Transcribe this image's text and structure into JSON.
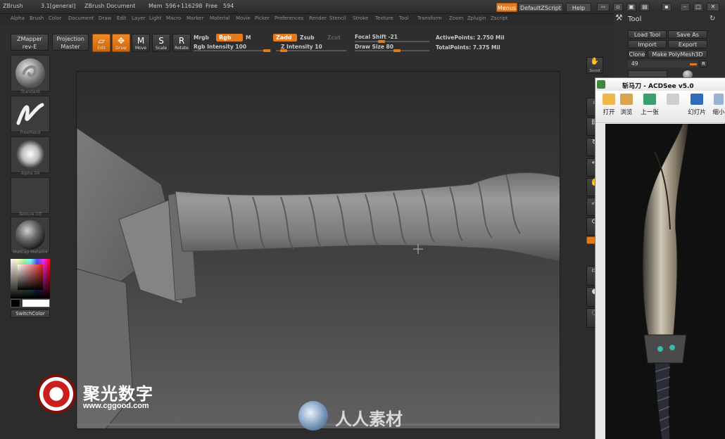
{
  "titlebar": {
    "app": "ZBrush",
    "version": "3.1[general]",
    "document": "ZBrush Document",
    "mem": "Mem",
    "mem_value": "596+116298",
    "free": "Free",
    "free_value": "594",
    "menus_btn": "Menus",
    "script_btn": "DefaultZScript",
    "help_btn": "Help"
  },
  "menubar": [
    "Alpha",
    "Brush",
    "Color",
    "Document",
    "Draw",
    "Edit",
    "Layer",
    "Light",
    "Macro",
    "Marker",
    "Material",
    "Movie",
    "Picker",
    "Preferences",
    "Render",
    "Stencil",
    "Stroke",
    "Texture",
    "Tool",
    "Transform",
    "Zoom",
    "Zplugin",
    "Zscript"
  ],
  "toolbar": {
    "zmapper": "ZMapper",
    "zmapper_sub": "rev-E",
    "projection": "Projection",
    "projection_sub": "Master",
    "edit": "Edit",
    "draw": "Draw",
    "move": "Move",
    "scale": "Scale",
    "rotate": "Rotate",
    "mrgb": "Mrgb",
    "rgb": "Rgb",
    "m": "M",
    "rgb_intensity": "Rgb Intensity 100",
    "zadd": "Zadd",
    "zsub": "Zsub",
    "zcut": "Zcut",
    "z_intensity": "Z Intensity 10",
    "focal_shift": "Focal Shift -21",
    "draw_size": "Draw Size 80",
    "active_points": "ActivePoints: 2.750 Mil",
    "total_points": "TotalPoints: 7.375 Mil"
  },
  "shelf": {
    "brush1": "Standard",
    "brush2": "FreeHand",
    "alpha": "Alpha 04",
    "texture": "Texture Off",
    "material": "MatCap Metal04",
    "switch_color": "SwitchColor"
  },
  "right_buttons": {
    "scroll": "Scroll"
  },
  "tool_panel": {
    "title": "Tool",
    "load": "Load Tool",
    "save": "Save As",
    "import": "Import",
    "export": "Export",
    "clone": "Clone",
    "make": "Make PolyMesh3D",
    "value": "49",
    "r": "R"
  },
  "acdsee": {
    "title": "斩马刀 - ACDSee v5.0",
    "btn_open": "打开",
    "btn_browse": "浏览",
    "btn_prev": "上一张",
    "btn_slideshow": "幻灯片",
    "btn_shrink": "缩小"
  },
  "watermark": {
    "cn": "聚光数字",
    "url": "www.cggood.com",
    "rr": "人人素材"
  },
  "colors": {
    "accent": "#e07b1f",
    "panel": "#2e2e2e",
    "canvas_top": "#2c2c2c",
    "canvas_bottom": "#616161"
  }
}
